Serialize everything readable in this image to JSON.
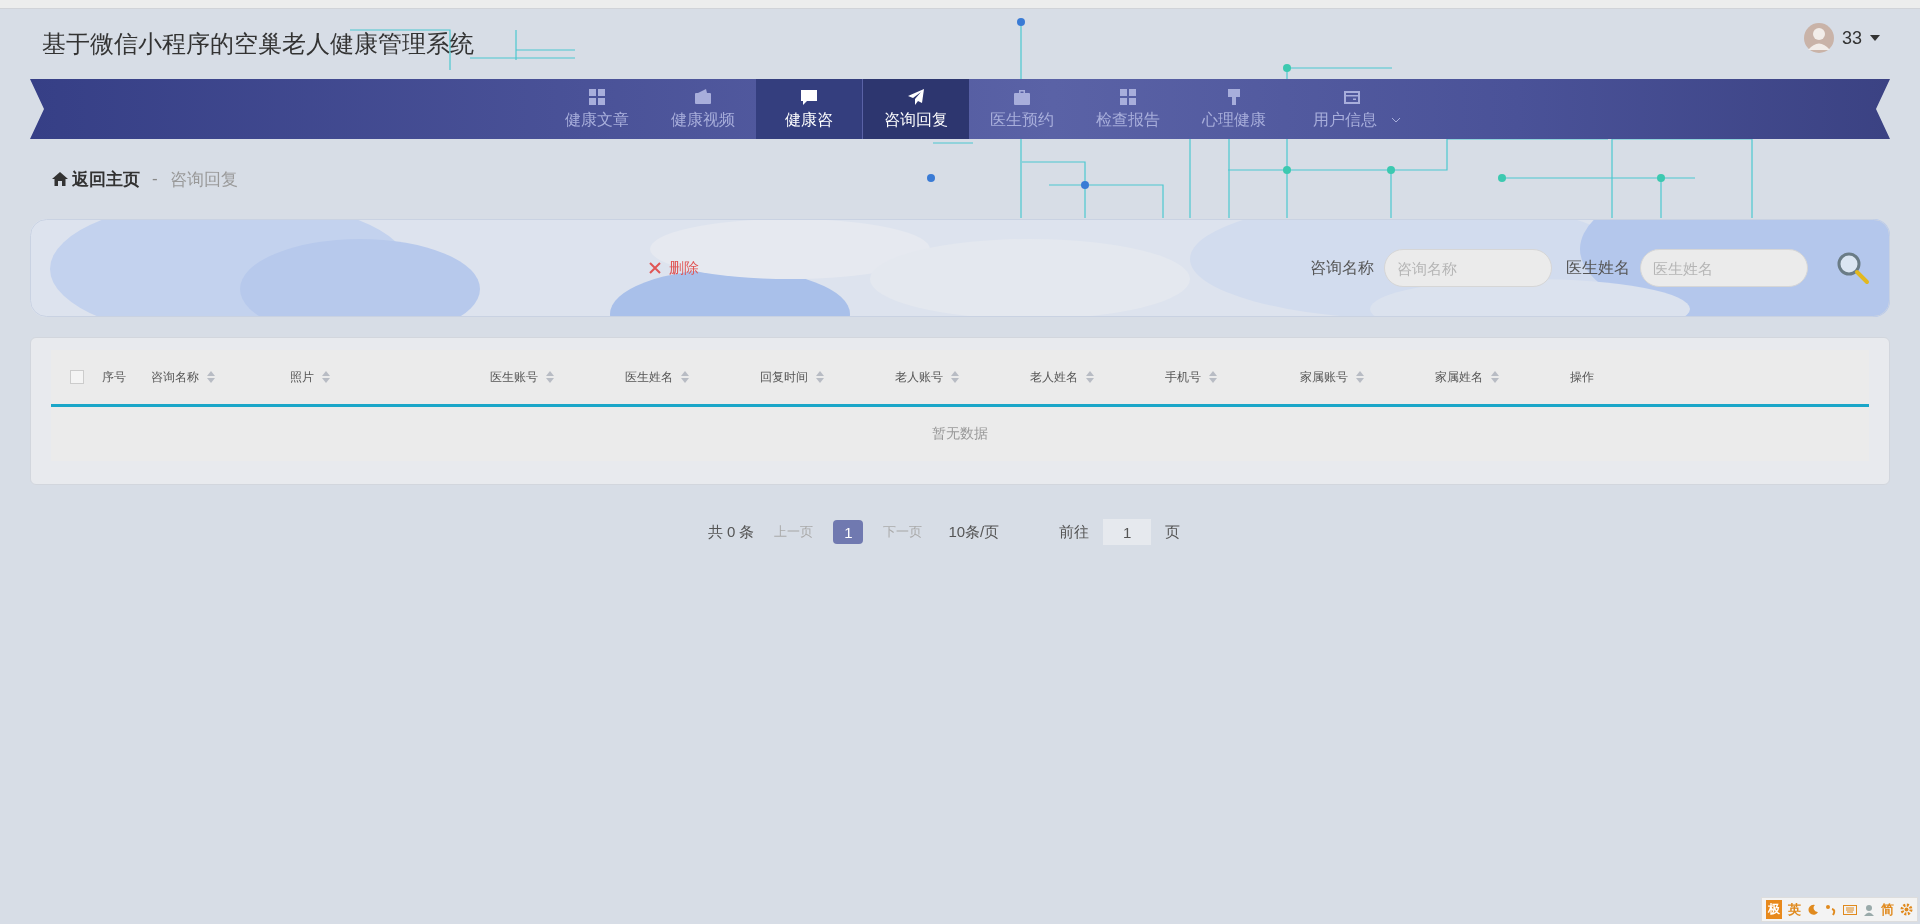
{
  "header": {
    "title": "基于微信小程序的空巢老人健康管理系统",
    "user": {
      "name": "33"
    }
  },
  "nav": [
    {
      "label": "健康文章",
      "kind": "grid",
      "selected": false,
      "hovered": false,
      "dropdown": false
    },
    {
      "label": "健康视频",
      "kind": "wallet",
      "selected": false,
      "hovered": false,
      "dropdown": false
    },
    {
      "label": "健康咨",
      "kind": "chat",
      "selected": false,
      "hovered": true,
      "dropdown": false
    },
    {
      "label": "咨询回复",
      "kind": "send",
      "selected": true,
      "hovered": false,
      "dropdown": false
    },
    {
      "label": "医生预约",
      "kind": "briefcase",
      "selected": false,
      "hovered": false,
      "dropdown": false
    },
    {
      "label": "检查报告",
      "kind": "grid",
      "selected": false,
      "hovered": false,
      "dropdown": false
    },
    {
      "label": "心理健康",
      "kind": "brush",
      "selected": false,
      "hovered": false,
      "dropdown": false
    },
    {
      "label": "用户信息",
      "kind": "card",
      "selected": false,
      "hovered": false,
      "dropdown": true
    }
  ],
  "breadcrumb": {
    "home": "返回主页",
    "separator": "-",
    "current": "咨询回复"
  },
  "toolbar": {
    "delete_button": "删除",
    "search_fields": [
      {
        "label": "咨询名称",
        "placeholder": "咨询名称"
      },
      {
        "label": "医生姓名",
        "placeholder": "医生姓名"
      }
    ]
  },
  "table": {
    "select_all_checked": false,
    "columns": [
      {
        "label": "序号",
        "sortable": false
      },
      {
        "label": "咨询名称",
        "sortable": true
      },
      {
        "label": "照片",
        "sortable": true
      },
      {
        "label": "医生账号",
        "sortable": true
      },
      {
        "label": "医生姓名",
        "sortable": true
      },
      {
        "label": "回复时间",
        "sortable": true
      },
      {
        "label": "老人账号",
        "sortable": true
      },
      {
        "label": "老人姓名",
        "sortable": true
      },
      {
        "label": "手机号",
        "sortable": true
      },
      {
        "label": "家属账号",
        "sortable": true
      },
      {
        "label": "家属姓名",
        "sortable": true
      },
      {
        "label": "操作",
        "sortable": false
      }
    ],
    "empty_text": "暂无数据"
  },
  "pagination": {
    "total": "共 0 条",
    "prev": "上一页",
    "pages": [
      {
        "label": "1",
        "selected": true
      }
    ],
    "next": "下一页",
    "page_size": "10条/页",
    "goto_label": "前往",
    "goto_value": "1",
    "goto_suffix": "页"
  },
  "ime_bar": {
    "items": [
      {
        "kind": "logo",
        "text": "极"
      },
      {
        "kind": "text",
        "text": "英"
      },
      {
        "kind": "moon"
      },
      {
        "kind": "punct"
      },
      {
        "kind": "keyboard"
      },
      {
        "kind": "user"
      },
      {
        "kind": "text",
        "text": "简"
      },
      {
        "kind": "gear"
      }
    ]
  }
}
